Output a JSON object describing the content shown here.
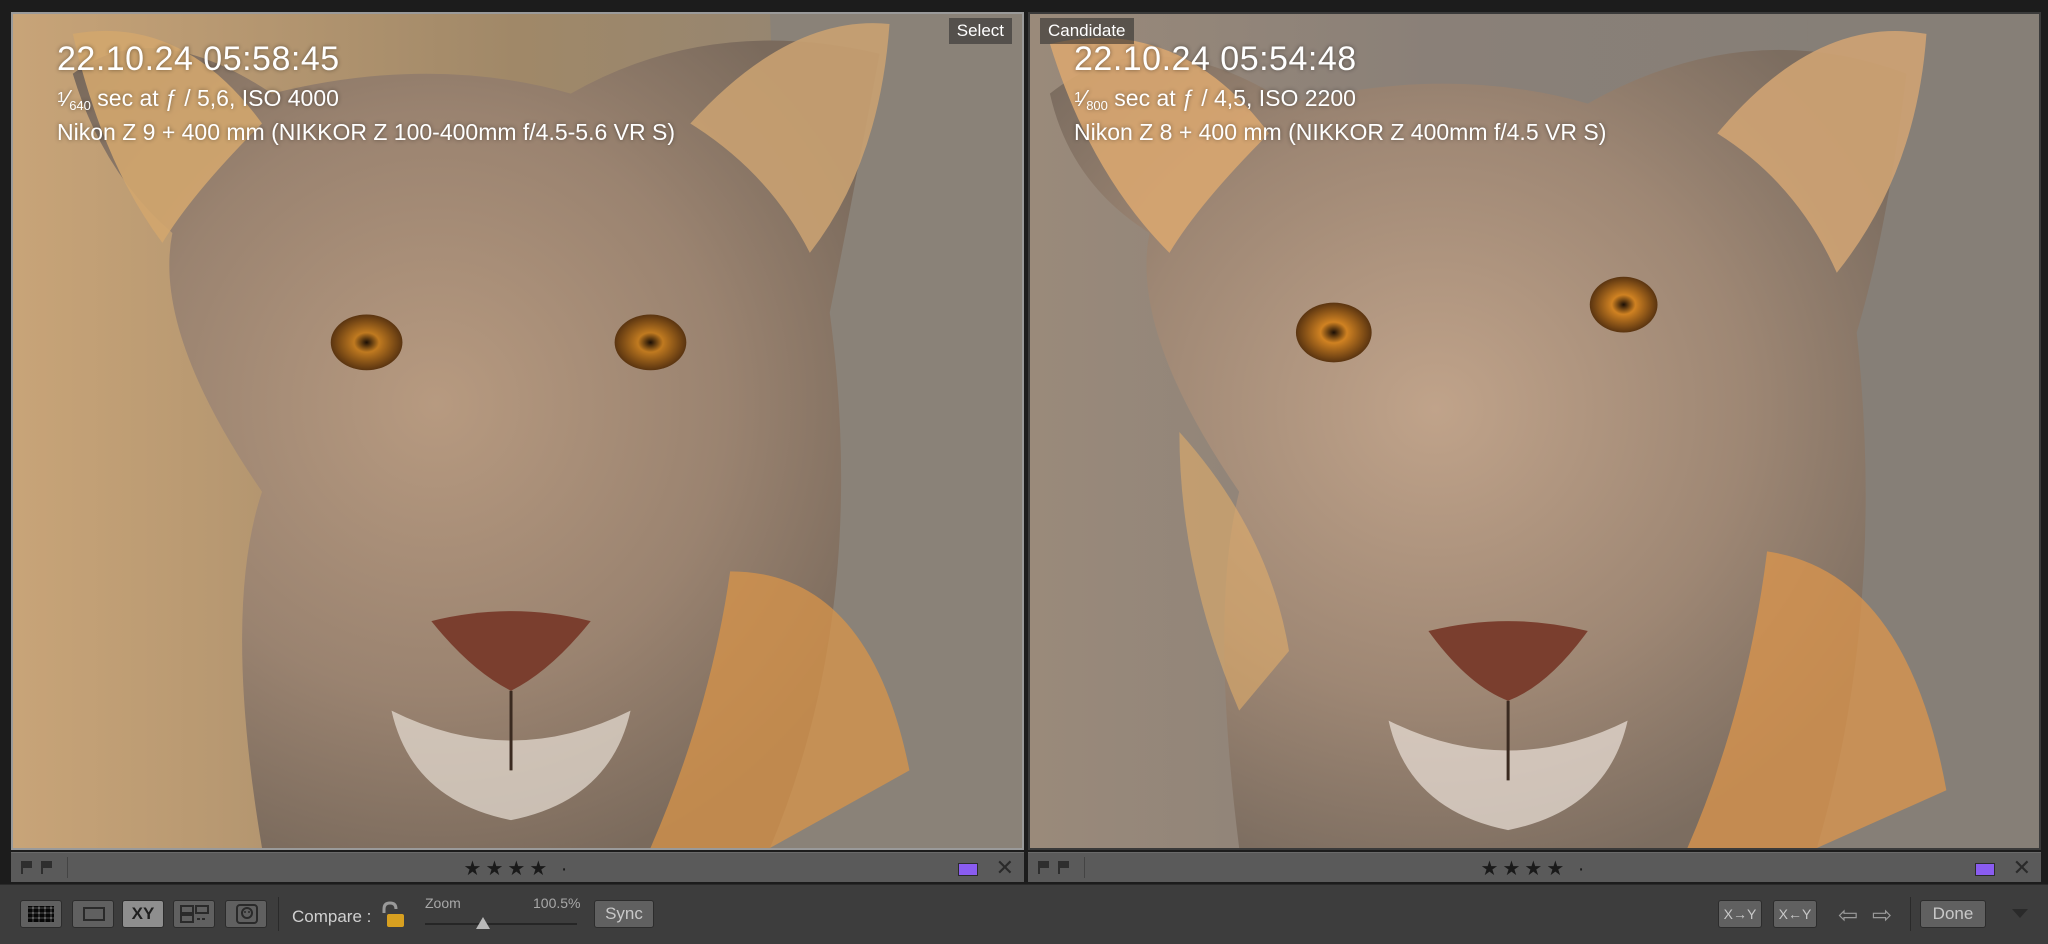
{
  "select_pane": {
    "tag": "Select",
    "date": "22.10.24 05:58:45",
    "shutter_num": "1",
    "shutter_den": "640",
    "exposure_rest": " sec at ƒ / 5,6, ISO 4000",
    "camera": "Nikon Z 9 + 400 mm (NIKKOR Z 100-400mm f/4.5-5.6 VR S)",
    "stars": "★★★★ ·",
    "label_color": "#8a5cf0"
  },
  "candidate_pane": {
    "tag": "Candidate",
    "date": "22.10.24 05:54:48",
    "shutter_num": "1",
    "shutter_den": "800",
    "exposure_rest": " sec at ƒ / 4,5, ISO 2200",
    "camera": "Nikon Z 8 + 400 mm (NIKKOR Z 400mm f/4.5 VR S)",
    "stars": "★★★★ ·",
    "label_color": "#8a5cf0"
  },
  "infobar": {
    "close_glyph": "✕"
  },
  "toolbar": {
    "compare_label": "Compare :",
    "zoom_label": "Zoom",
    "zoom_value": "100.5%",
    "zoom_fraction": 0.38,
    "sync_label": "Sync",
    "compare_view_label": "XY",
    "swap_label": "X→Y",
    "make_select_label": "X←Y",
    "prev_glyph": "⇦",
    "next_glyph": "⇨",
    "done_label": "Done"
  },
  "icons": [
    "flag-icon",
    "reject-flag-icon",
    "grid-view-icon",
    "loupe-view-icon",
    "compare-view-icon",
    "survey-view-icon",
    "people-view-icon",
    "lock-icon",
    "swap-icon",
    "make-select-icon",
    "prev-arrow-icon",
    "next-arrow-icon",
    "menu-triangle-icon"
  ]
}
